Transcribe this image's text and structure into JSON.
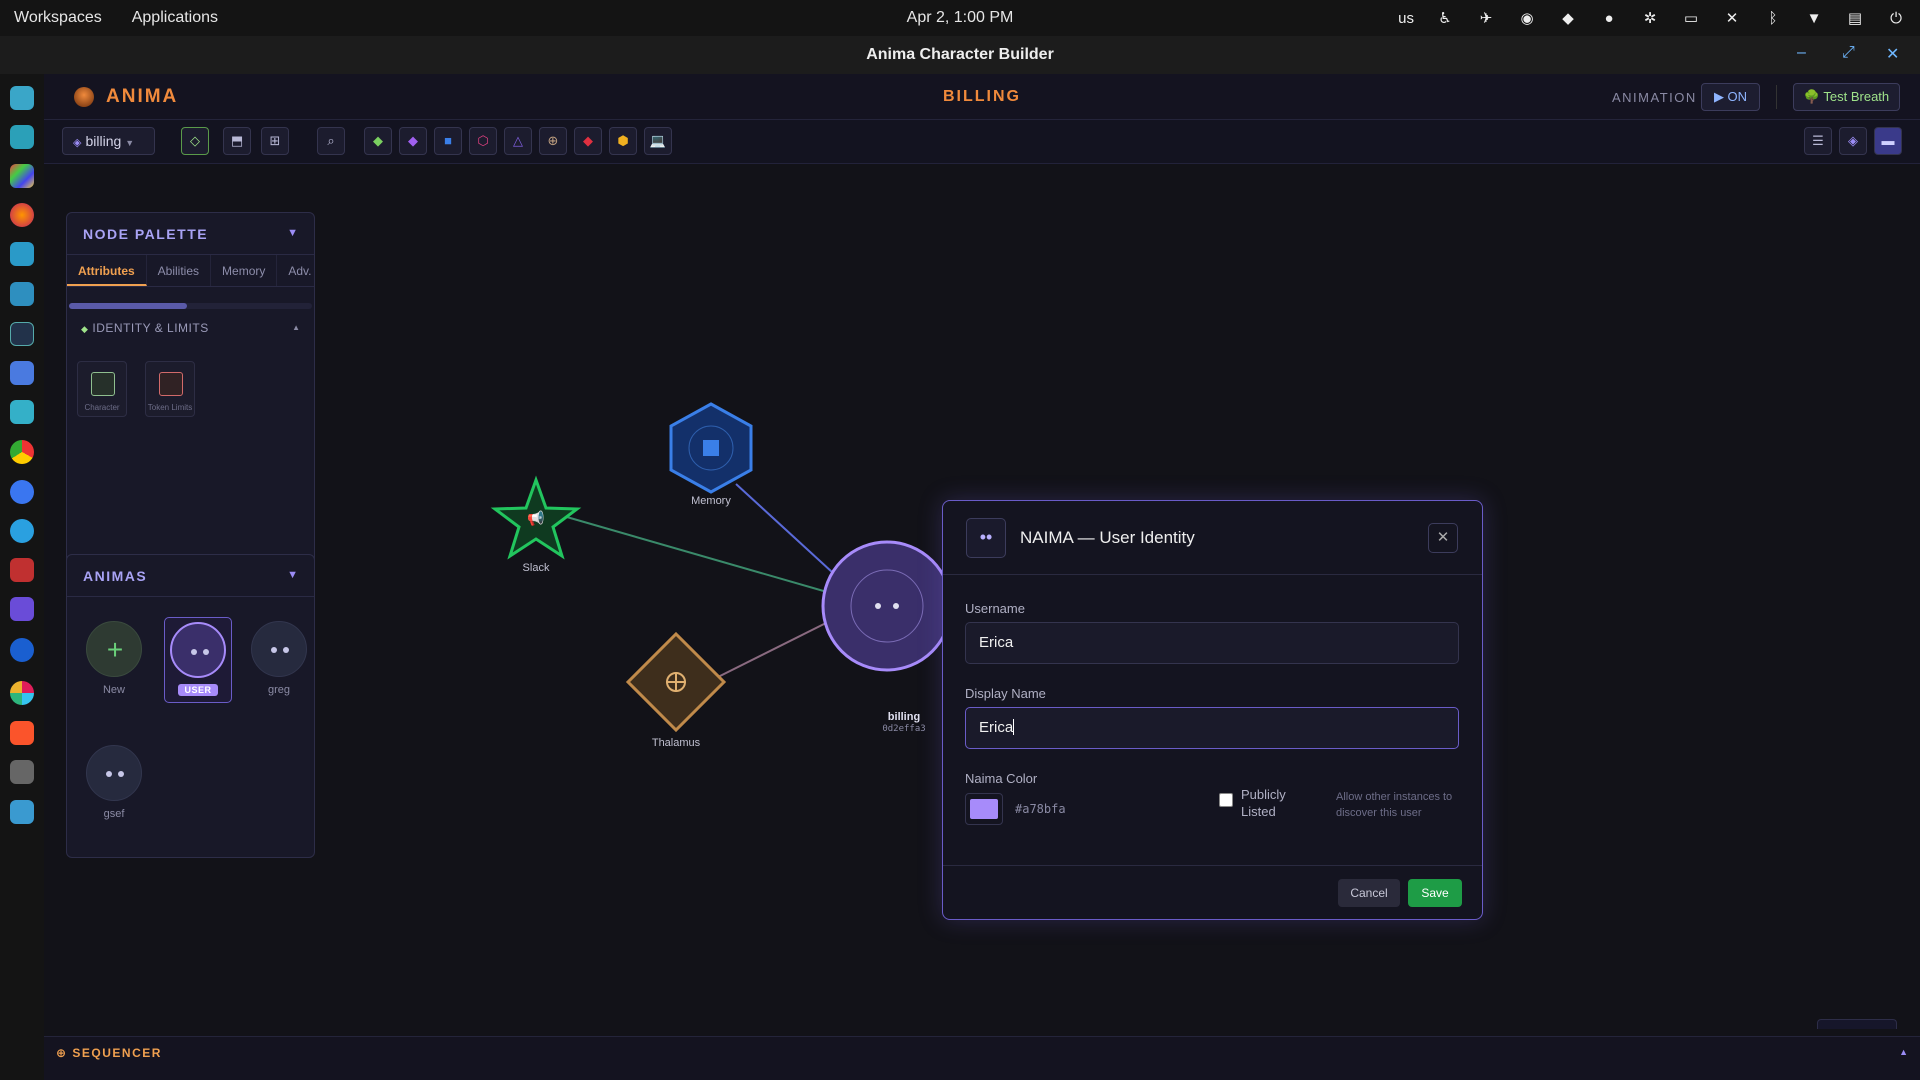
{
  "system": {
    "menu": [
      "Workspaces",
      "Applications"
    ],
    "clock": "Apr 2, 1:00 PM",
    "keyboard_layout": "us",
    "tray_icons": [
      "accessibility-icon",
      "telegram-icon",
      "password-manager-icon",
      "dropbox-icon",
      "indicator-icon",
      "slack-icon",
      "display-icon",
      "mute-icon",
      "bluetooth-icon",
      "wifi-icon",
      "battery-icon",
      "power-icon"
    ]
  },
  "window": {
    "title": "Anima Character Builder",
    "controls": [
      "minimize-icon",
      "maximize-icon",
      "close-icon"
    ]
  },
  "dock": {
    "apps": [
      "search-app",
      "workspace-app",
      "app-grid",
      "firefox",
      "files",
      "text-editor",
      "terminal",
      "store",
      "backup",
      "chrome",
      "signal",
      "telegram",
      "presentation",
      "mail",
      "1password",
      "slack",
      "brave",
      "settings",
      "image-viewer"
    ]
  },
  "header": {
    "brand": "ANIMA",
    "section": "BILLING",
    "animation_label": "ANIMATION",
    "animation_toggle": "▶ ON",
    "test_breath": "🌳 Test Breath"
  },
  "toolbar": {
    "anima_select": "billing",
    "buttons": [
      "◇",
      "⬒",
      "⊞",
      "⌕"
    ],
    "node_types": [
      "◆",
      "◆",
      "■",
      "⬡",
      "△",
      "⊕",
      "◆",
      "⬢",
      "💻"
    ],
    "right_buttons": [
      "☰",
      "◈",
      "▬"
    ]
  },
  "palette": {
    "title": "NODE PALETTE",
    "tabs": [
      "Attributes",
      "Abilities",
      "Memory",
      "Adv. Cog"
    ],
    "active_tab": "Attributes",
    "group": "IDENTITY & LIMITS",
    "items": [
      {
        "label": "Character",
        "color": "#8fbf8f"
      },
      {
        "label": "Token Limits",
        "color": "#d26a6a"
      }
    ]
  },
  "animas": {
    "title": "ANIMAS",
    "items": [
      {
        "label": "New"
      },
      {
        "label": "USER",
        "badge": "USER"
      },
      {
        "label": "greg"
      },
      {
        "label": "gsef"
      }
    ]
  },
  "graph": {
    "nodes": [
      {
        "label": "Memory",
        "color": "#3a7fe8"
      },
      {
        "label": "Slack",
        "color": "#22c55e"
      },
      {
        "label": "billing",
        "sublabel": "0d2effa3",
        "color": "#a78bfa"
      },
      {
        "label": "Thalamus",
        "color": "#c08a4a"
      }
    ]
  },
  "modal": {
    "title": "NAIMA — User Identity",
    "avatar": "••",
    "username_label": "Username",
    "username_value": "Erica",
    "display_name_label": "Display Name",
    "display_name_value": "Erica",
    "color_label": "Naima Color",
    "color_value": "#a78bfa",
    "public_label": "Publicly Listed",
    "public_checked": false,
    "public_hint": "Allow other instances to discover this user",
    "cancel": "Cancel",
    "save": "Save"
  },
  "sequencer": {
    "title": "⊕ SEQUENCER"
  }
}
